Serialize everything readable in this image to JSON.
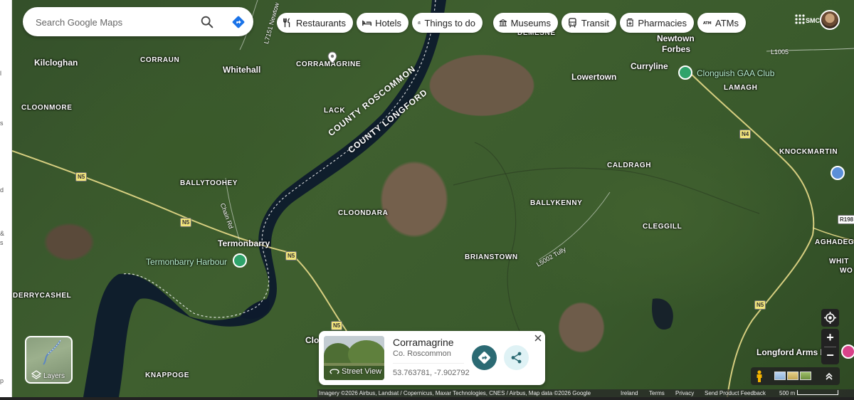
{
  "search": {
    "placeholder": "Search Google Maps"
  },
  "icons": {
    "search": "search-icon",
    "directions": "directions-icon",
    "apps": "apps-grid-icon",
    "locate": "my-location-icon",
    "layers": "layers-icon",
    "pegman": "pegman-icon",
    "share": "share-icon",
    "close": "close-icon",
    "street_view": "street-view-icon"
  },
  "chips": [
    {
      "label": "Restaurants",
      "icon": "restaurant-icon"
    },
    {
      "label": "Hotels",
      "icon": "hotel-icon"
    },
    {
      "label": "Things to do",
      "icon": "camera-icon"
    },
    {
      "label": "Museums",
      "icon": "museum-icon"
    },
    {
      "label": "Transit",
      "icon": "transit-icon"
    },
    {
      "label": "Pharmacies",
      "icon": "pharmacy-icon"
    },
    {
      "label": "ATMs",
      "icon": "atm-icon"
    }
  ],
  "account": {
    "label": "SMC"
  },
  "map": {
    "places": [
      "Kilcloghan",
      "CORRAUN",
      "Whitehall",
      "CORRAMAGRINE",
      "CLOONMORE",
      "LACK",
      "BALLYTOOHEY",
      "CLOONDARA",
      "Termonbarry",
      "Termonbarry Harbour",
      "DERRYCASHEL",
      "KNAPPOGE",
      "Clo",
      "BALLYKENNY",
      "BRIANSTOWN",
      "CALDRAGH",
      "CLEGGILL",
      "Lowertown",
      "Curryline",
      "Newtown",
      "Forbes",
      "Clonguish GAA Club",
      "LAMAGH",
      "KNOCKMARTIN",
      "AGHADEG",
      "WHIT",
      "WO",
      "Longford Arms I",
      "DEMESNE"
    ],
    "counties": [
      "COUNTY ROSCOMMON",
      "COUNTY LONGFORD"
    ],
    "roads": [
      "N5",
      "N5",
      "N5",
      "N5",
      "N4",
      "N5",
      "L1005",
      "R198",
      "L5002 Tully",
      "Chain Rd",
      "L7151 Newtow"
    ],
    "colors": {
      "water": "#0d1a2c",
      "poi_pin": "#2fa36b",
      "road": "#e8dc8a"
    }
  },
  "card": {
    "title": "Corramagrine",
    "subtitle": "Co. Roscommon",
    "coords": "53.763781, -7.902792",
    "street_view": "Street View",
    "directions": "directions-icon",
    "share": "share-icon"
  },
  "layers": {
    "label": "Layers"
  },
  "zoom": {
    "in": "+",
    "out": "−"
  },
  "attribution": {
    "imagery": "Imagery ©2026 Airbus, Landsat / Copernicus, Maxar Technologies, CNES / Airbus, Map data ©2026 Google",
    "country": "Ireland",
    "terms": "Terms",
    "privacy": "Privacy",
    "feedback": "Send Product Feedback",
    "scale": "500 m"
  },
  "left_fragments": [
    "l",
    "s",
    "d",
    "&",
    "s",
    "p"
  ]
}
